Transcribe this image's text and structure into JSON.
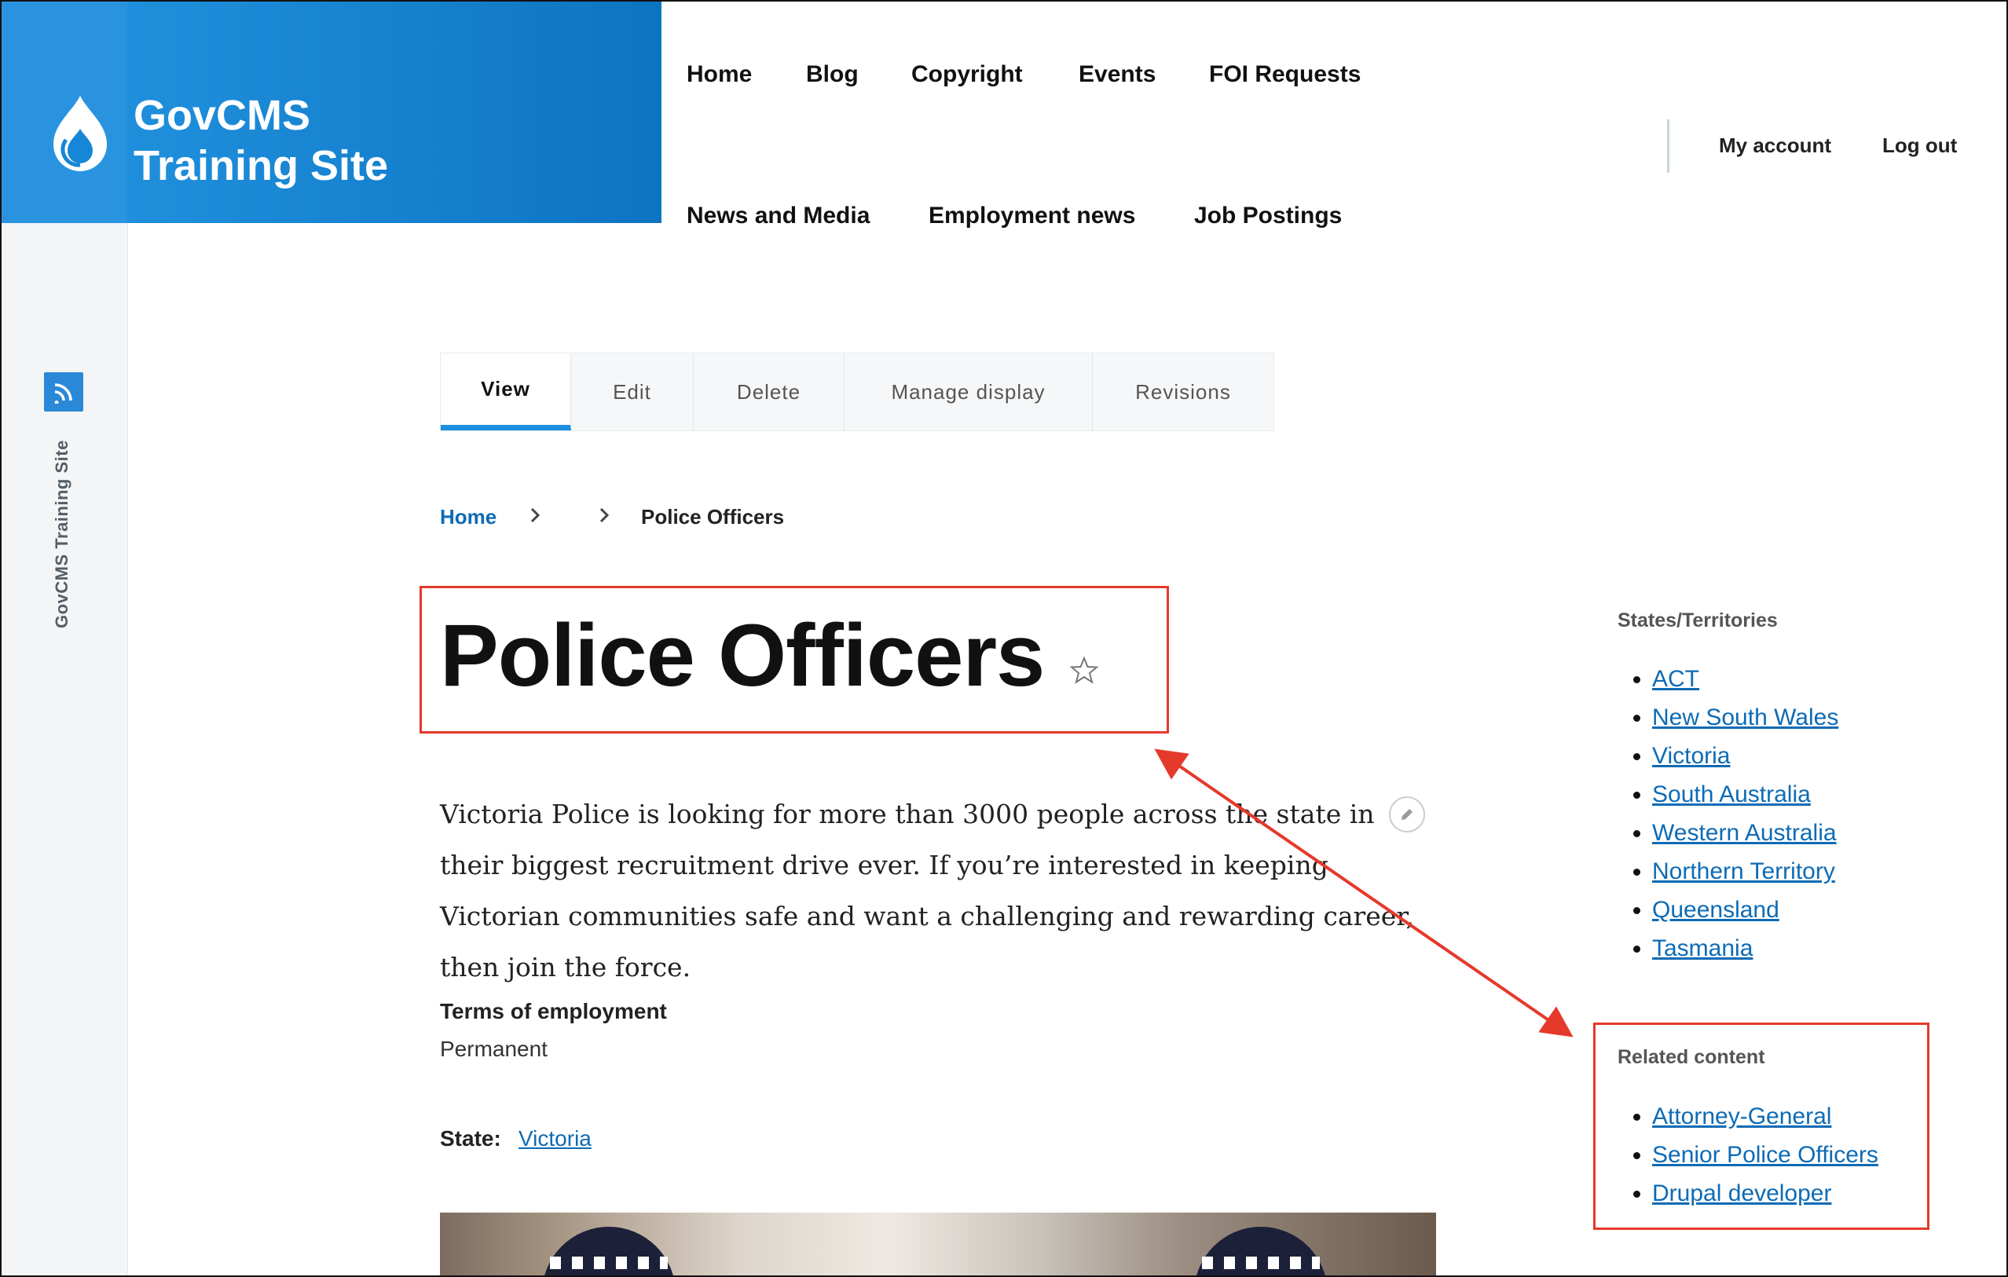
{
  "site": {
    "title_line1": "GovCMS",
    "title_line2": "Training Site",
    "toolbar_label": "GovCMS Training Site"
  },
  "nav": {
    "row1": [
      "Home",
      "Blog",
      "Copyright",
      "Events",
      "FOI Requests"
    ],
    "row2": [
      "News and Media",
      "Employment news",
      "Job Postings"
    ]
  },
  "user_menu": {
    "account": "My account",
    "logout": "Log out"
  },
  "tabs": [
    "View",
    "Edit",
    "Delete",
    "Manage display",
    "Revisions"
  ],
  "breadcrumb": {
    "home": "Home",
    "current": "Police Officers"
  },
  "page": {
    "title": "Police Officers",
    "body": "Victoria Police is looking for more than 3000 people across the state in their biggest recruitment drive ever. If you’re interested in keeping Victorian communities safe and want a challenging and rewarding career, then join the force.",
    "terms_label": "Terms of employment",
    "terms_value": "Permanent",
    "state_label": "State:",
    "state_value": "Victoria"
  },
  "sidebar": {
    "states_heading": "States/Territories",
    "states": [
      "ACT",
      "New South Wales",
      "Victoria",
      "South Australia",
      "Western Australia",
      "Northern Territory",
      "Queensland",
      "Tasmania"
    ],
    "related_heading": "Related content",
    "related": [
      "Attorney-General",
      "Senior Police Officers",
      "Drupal developer"
    ]
  },
  "colors": {
    "brand": "#1478c8",
    "link": "#0d6bb5",
    "annotation": "#e5392c",
    "tab_active": "#1d8fe0"
  }
}
